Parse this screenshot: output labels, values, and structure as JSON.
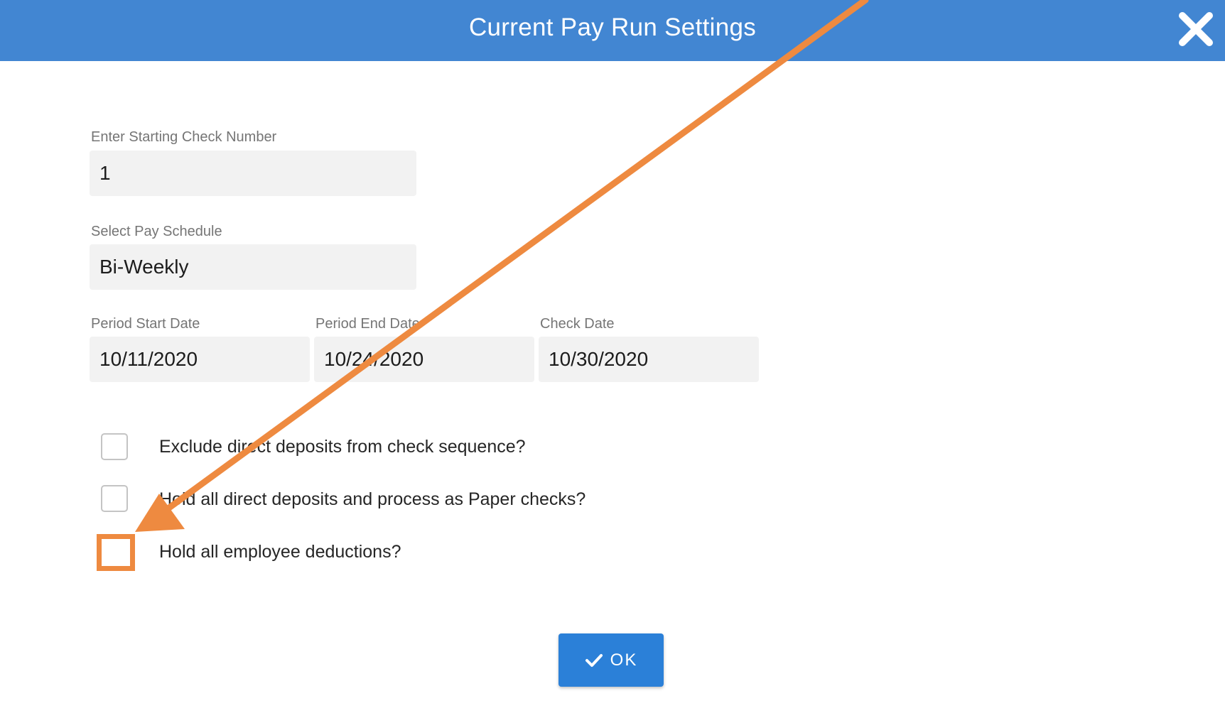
{
  "dialog": {
    "title": "Current Pay Run Settings",
    "close_icon": "close-x-icon"
  },
  "form": {
    "check_number": {
      "label": "Enter Starting Check Number",
      "value": "1"
    },
    "pay_schedule": {
      "label": "Select Pay Schedule",
      "value": "Bi-Weekly"
    },
    "period_start": {
      "label": "Period Start Date",
      "value": "10/11/2020"
    },
    "period_end": {
      "label": "Period End Date",
      "value": "10/24/2020"
    },
    "check_date": {
      "label": "Check Date",
      "value": "10/30/2020"
    }
  },
  "options": [
    {
      "label": "Exclude direct deposits from check sequence?",
      "checked": false
    },
    {
      "label": "Hold all direct deposits and process as Paper checks?",
      "checked": false
    },
    {
      "label": "Hold all employee deductions?",
      "checked": false,
      "highlighted": true
    }
  ],
  "ok_button": {
    "label": "OK",
    "icon": "checkmark-icon"
  },
  "colors": {
    "header": "#4286d2",
    "button": "#2b80d8",
    "annotation": "#ee8a40"
  }
}
